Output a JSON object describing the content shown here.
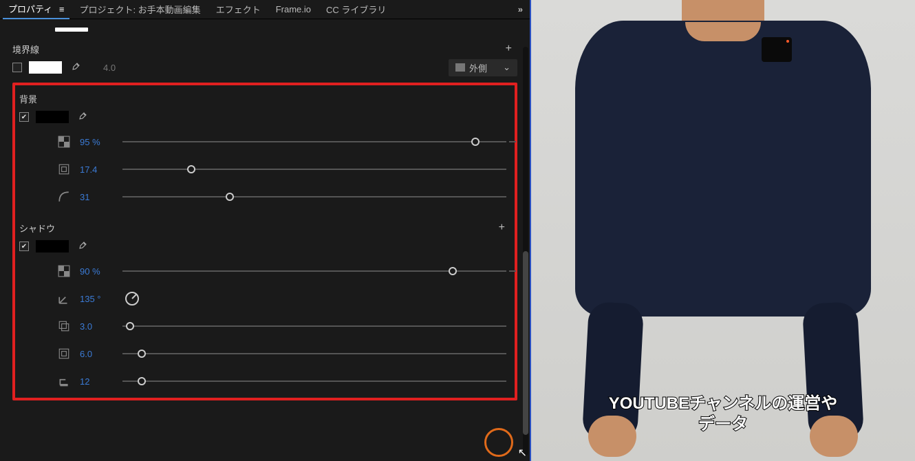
{
  "tabs": {
    "active": "プロパティ",
    "items": [
      "プロパティ",
      "プロジェクト: お手本動画編集",
      "エフェクト",
      "Frame.io",
      "CC ライブラリ"
    ]
  },
  "border": {
    "title": "境界線",
    "checked": false,
    "swatch_color": "#ffffff",
    "width": "4.0",
    "position_label": "外側"
  },
  "background": {
    "title": "背景",
    "checked": true,
    "swatch_color": "#000000",
    "params": [
      {
        "icon": "opacity-icon",
        "value": "95 %",
        "pos": 92
      },
      {
        "icon": "size-icon",
        "value": "17.4",
        "pos": 18
      },
      {
        "icon": "radius-icon",
        "value": "31",
        "pos": 28
      }
    ]
  },
  "shadow": {
    "title": "シャドウ",
    "checked": true,
    "swatch_color": "#000000",
    "opacity": {
      "value": "90 %",
      "pos": 86
    },
    "angle": {
      "value": "135 °"
    },
    "distance": {
      "value": "3.0",
      "pos": 2
    },
    "size": {
      "value": "6.0",
      "pos": 5
    },
    "blur": {
      "value": "12",
      "pos": 5
    }
  },
  "preview": {
    "caption_line1": "YOUTUBEチャンネルの運営や",
    "caption_line2": "データ"
  }
}
